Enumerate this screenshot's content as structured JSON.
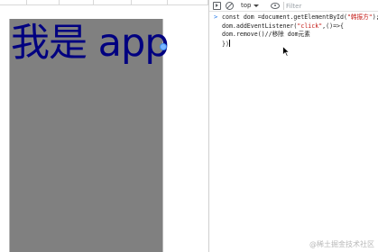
{
  "app": {
    "heading": "我是 app"
  },
  "devtools": {
    "context": "top",
    "filter_placeholder": "Filter",
    "prompt": ">",
    "console_lines": [
      {
        "pre": "const dom =document.getElementById(",
        "str": "\"韩振方\"",
        "post": ");"
      },
      {
        "pre": "dom.addEventListener(",
        "str": "\"click\"",
        "post": ",()=>{"
      },
      {
        "pre": "dom.remove()//移除 dom元素",
        "str": "",
        "post": ""
      },
      {
        "pre": "})",
        "str": "",
        "post": ""
      }
    ]
  },
  "watermark": "@稀土掘金技术社区",
  "icons": {
    "panel": "panel-toggle-icon",
    "clear": "clear-console-icon",
    "eye": "eye-icon",
    "caret": "chevron-down-icon",
    "pointer": "mouse-pointer-icon"
  },
  "colors": {
    "app_text": "#000080",
    "device_bg": "#808080",
    "string": "#c41a16",
    "prompt": "#1a73e8"
  }
}
